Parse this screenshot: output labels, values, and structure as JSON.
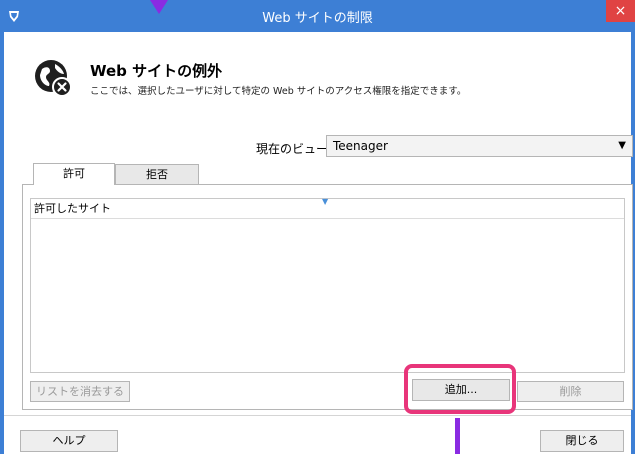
{
  "window": {
    "title": "Web サイトの制限",
    "close_glyph": "×",
    "colors": {
      "titlebar": "#3d7fd5",
      "highlight": "#e8357a",
      "arrow": "#8a2be2"
    }
  },
  "header": {
    "title": "Web サイトの例外",
    "subtitle": "ここでは、選択したユーザに対して特定の Web サイトのアクセス権限を指定できます。",
    "icon": "globe-blocked-icon"
  },
  "view": {
    "label": "現在のビュー:",
    "selected": "Teenager"
  },
  "tabs": [
    {
      "label": "許可",
      "active": true
    },
    {
      "label": "拒否",
      "active": false
    }
  ],
  "list": {
    "header": "許可したサイト",
    "items": []
  },
  "buttons": {
    "clear": "リストを消去する",
    "add": "追加...",
    "delete": "削除",
    "help": "ヘルプ",
    "close": "閉じる"
  }
}
